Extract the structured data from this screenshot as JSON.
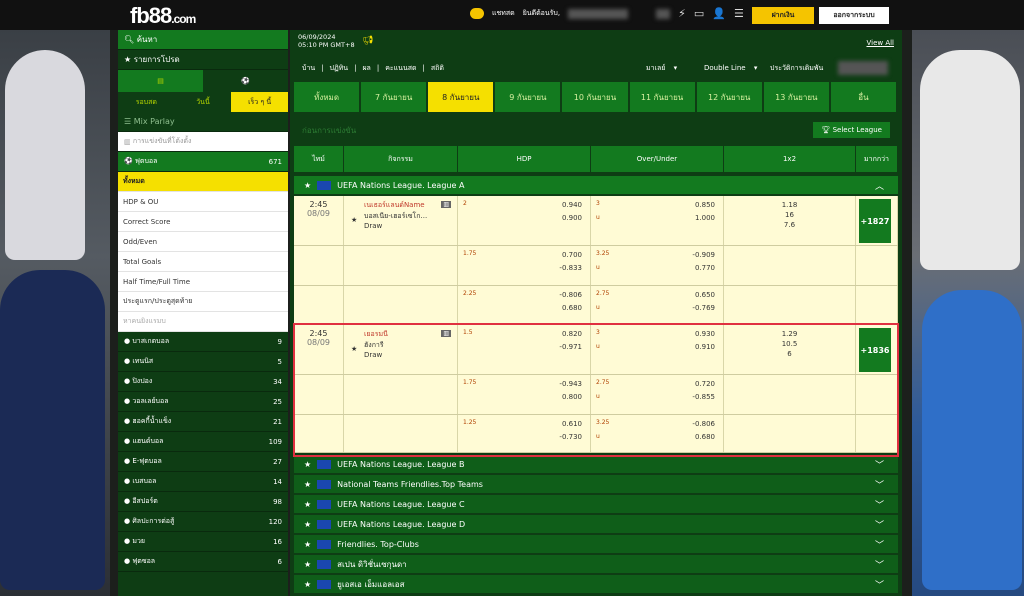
{
  "header": {
    "logo_main": "fb88",
    "logo_dot": ".com",
    "chat": "แชทสด",
    "welcome": "ยินดีต้อนรับ,",
    "deposit": "ฝากเงิน",
    "logout": "ออกจากระบบ"
  },
  "sidebar": {
    "search": "ค้นหา",
    "favorites": "รายการโปรด",
    "tab_live": "รอบสด",
    "tab_today": "วันนี้",
    "tab_early": "เร็ว ๆ นี้",
    "mix_parlay": "Mix Parlay",
    "my_bets": "การแข่งขันที่โต้งตั้ง",
    "football_label": "ฟุตบอล",
    "football_count": "671",
    "bet_types": [
      "ทั้งหมด",
      "HDP & OU",
      "Correct Score",
      "Odd/Even",
      "Total Goals",
      "Half Time/Full Time",
      "ประตูแรก/ประตูสุดท้าย",
      "หาคนยิงแรมบ"
    ],
    "sports": [
      {
        "name": "บาสเกตบอล",
        "count": "9"
      },
      {
        "name": "เทนนิส",
        "count": "5"
      },
      {
        "name": "ปิงปอง",
        "count": "34"
      },
      {
        "name": "วอลเลย์บอล",
        "count": "25"
      },
      {
        "name": "ฮอคกี้น้ำแข็ง",
        "count": "21"
      },
      {
        "name": "แฮนด์บอล",
        "count": "109"
      },
      {
        "name": "E-ฟุตบอล",
        "count": "27"
      },
      {
        "name": "เบสบอล",
        "count": "14"
      },
      {
        "name": "อีสปอร์ต",
        "count": "98"
      },
      {
        "name": "ศิลปะการต่อสู้",
        "count": "120"
      },
      {
        "name": "มวย",
        "count": "16"
      },
      {
        "name": "ฟุตซอล",
        "count": "6"
      }
    ]
  },
  "main": {
    "date": "06/09/2024",
    "time": "05:10 PM GMT+8",
    "view_all": "View All",
    "nav": [
      "บ้าน",
      "ปฏิทิน",
      "ผล",
      "คะแนนสด",
      "สถิติ"
    ],
    "market": "มาเลย์",
    "line": "Double Line",
    "history": "ประวัติการเดิมพัน",
    "days": [
      "ทั้งหมด",
      "7 กันยายน",
      "8 กันยายน",
      "9 กันยายน",
      "10 กันยายน",
      "11 กันยายน",
      "12 กันยายน",
      "13 กันยายน",
      "อื่น"
    ],
    "section": "ก่อนการแข่งขัน",
    "select_league": "Select League",
    "cols": [
      "ไทม์",
      "กิจกรรม",
      "HDP",
      "Over/Under",
      "1x2",
      "มากกว่า"
    ],
    "league_a": "UEFA Nations League. League A",
    "m1": {
      "time": "2:45",
      "date": "08/09",
      "home": "เนเธอร์แลนด์Name",
      "away": "บอสเนีย-เฮอร์เซโก...",
      "draw": "Draw",
      "more": "+1827",
      "r1": {
        "hl": "2",
        "h1": "0.940",
        "h2": "0.900",
        "ol": "3",
        "o1": "0.850",
        "ou": "u",
        "o2": "1.000",
        "x1": "1.18",
        "x2": "16",
        "x3": "7.6"
      },
      "r2": {
        "hl": "1.75",
        "h1": "0.700",
        "h2": "-0.833",
        "ol": "3.25",
        "o1": "-0.909",
        "ou": "u",
        "o2": "0.770"
      },
      "r3": {
        "hl": "2.25",
        "h1": "-0.806",
        "h2": "0.680",
        "ol": "2.75",
        "o1": "0.650",
        "ou": "u",
        "o2": "-0.769"
      }
    },
    "m2": {
      "time": "2:45",
      "date": "08/09",
      "home": "เยอรมนี",
      "away": "ฮังการี",
      "draw": "Draw",
      "more": "+1836",
      "r1": {
        "hl": "1.5",
        "h1": "0.820",
        "h2": "-0.971",
        "ol": "3",
        "o1": "0.930",
        "ou": "u",
        "o2": "0.910",
        "x1": "1.29",
        "x2": "10.5",
        "x3": "6"
      },
      "r2": {
        "hl": "1.75",
        "h1": "-0.943",
        "h2": "0.800",
        "ol": "2.75",
        "o1": "0.720",
        "ou": "u",
        "o2": "-0.855"
      },
      "r3": {
        "hl": "1.25",
        "h1": "0.610",
        "h2": "-0.730",
        "ol": "3.25",
        "o1": "-0.806",
        "ou": "u",
        "o2": "0.680"
      }
    },
    "leagues": [
      "UEFA Nations League. League B",
      "National Teams Friendlies.Top Teams",
      "UEFA Nations League. League C",
      "UEFA Nations League. League D",
      "Friendlies. Top-Clubs",
      "สเปน ดิวิชั่นเซกุนดา",
      "ยูเอสเอ เอ็มแอลเอส"
    ]
  }
}
